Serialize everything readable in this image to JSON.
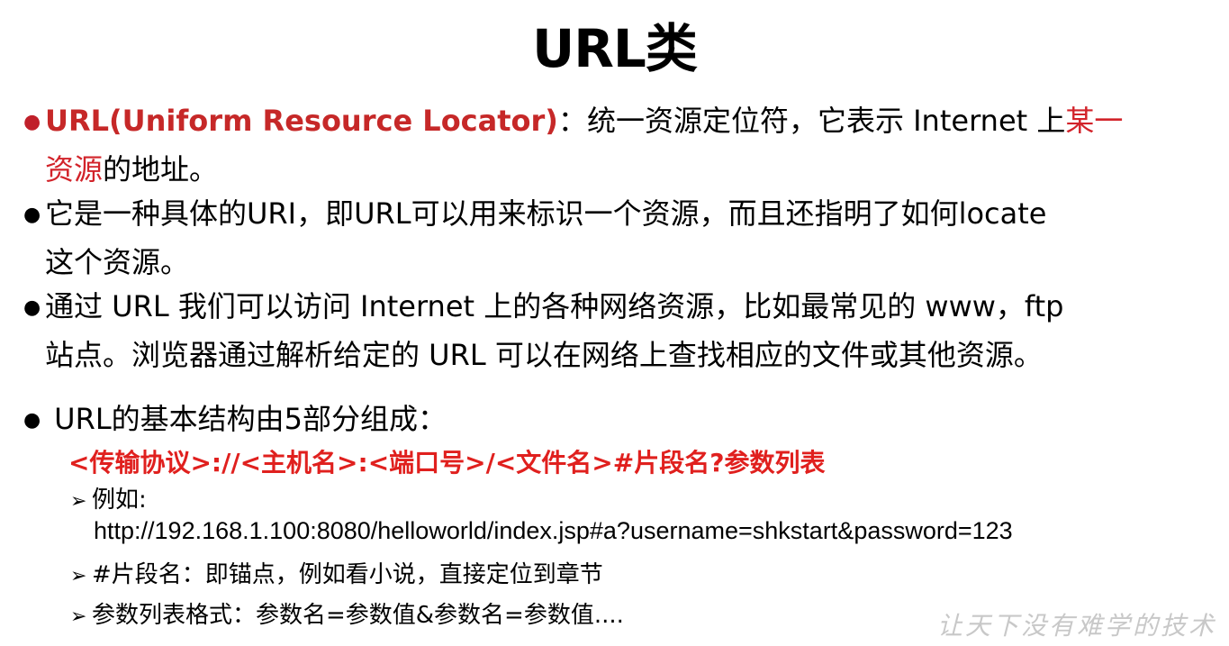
{
  "title": "URL类",
  "bullets": [
    {
      "term": "URL(Uniform Resource Locator)",
      "sep": "：",
      "text_before": "统一资源定位符，它表示 Internet 上",
      "text_red_1": "某一",
      "text_red_2": "资源",
      "text_after": "的地址。"
    },
    {
      "line1": "它是一种具体的URI，即URL可以用来标识一个资源，而且还指明了如何locate",
      "line2": "这个资源。"
    },
    {
      "line1": "通过 URL 我们可以访问 Internet 上的各种网络资源，比如最常见的 www，ftp",
      "line2": "站点。浏览器通过解析给定的 URL 可以在网络上查找相应的文件或其他资源。"
    },
    {
      "line1": "URL的基本结构由5部分组成："
    }
  ],
  "structure": "<传输协议>://<主机名>:<端口号>/<文件名>#片段名?参数列表",
  "sub_items": {
    "example_label": "例如:",
    "example_url": "http://192.168.1.100:8080/helloworld/index.jsp#a?username=shkstart&password=123",
    "fragment": "#片段名：即锚点，例如看小说，直接定位到章节",
    "params": "参数列表格式：参数名=参数值&参数名=参数值...."
  },
  "watermark": "让天下没有难学的技术",
  "colors": {
    "accent_red": "#d2232a",
    "structure_red": "#e0201e"
  },
  "icons": {
    "bullet": "●",
    "arrow": "➢"
  }
}
